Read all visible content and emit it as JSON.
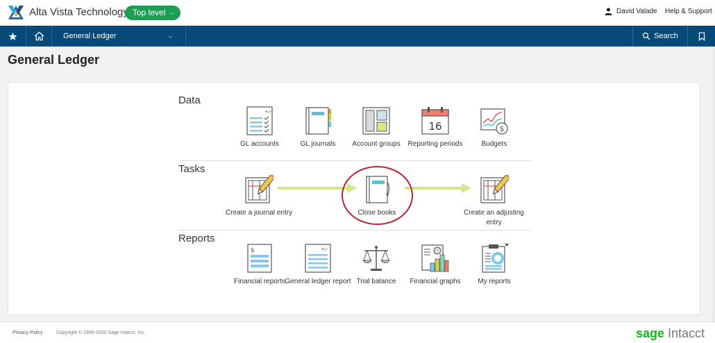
{
  "topbar": {
    "company": "Alta Vista Technology",
    "entity_badge": "Top level",
    "user_name": "David Valade",
    "help": "Help & Support"
  },
  "navbar": {
    "module": "General Ledger",
    "search": "Search"
  },
  "page": {
    "title": "General Ledger"
  },
  "sections": {
    "data": {
      "title": "Data",
      "items": [
        {
          "label": "GL accounts",
          "icon": "gl-accounts-icon"
        },
        {
          "label": "GL journals",
          "icon": "gl-journals-icon"
        },
        {
          "label": "Account groups",
          "icon": "account-groups-icon"
        },
        {
          "label": "Reporting periods",
          "icon": "calendar-icon",
          "day": "16"
        },
        {
          "label": "Budgets",
          "icon": "budgets-icon"
        }
      ]
    },
    "tasks": {
      "title": "Tasks",
      "items": [
        {
          "label": "Create a journal entry",
          "icon": "journal-entry-icon"
        },
        {
          "label": "Close books",
          "icon": "close-books-icon"
        },
        {
          "label": "Create an adjusting entry",
          "icon": "adjusting-entry-icon"
        }
      ]
    },
    "reports": {
      "title": "Reports",
      "items": [
        {
          "label": "Financial reports",
          "icon": "financial-reports-icon"
        },
        {
          "label": "General ledger report",
          "icon": "gl-report-icon"
        },
        {
          "label": "Trial balance",
          "icon": "scale-icon"
        },
        {
          "label": "Financial graphs",
          "icon": "graphs-icon"
        },
        {
          "label": "My reports",
          "icon": "clipboard-icon"
        }
      ]
    }
  },
  "footer": {
    "privacy": "Privacy Policy",
    "copyright": "Copyright © 1999-2020 Sage Intacct, Inc.",
    "brand_sage": "sage",
    "brand_intacct": "Intacct"
  },
  "colors": {
    "nav": "#074a78",
    "badge": "#1d9e54",
    "arrow": "#d4e68a",
    "highlight": "#b8232f"
  }
}
